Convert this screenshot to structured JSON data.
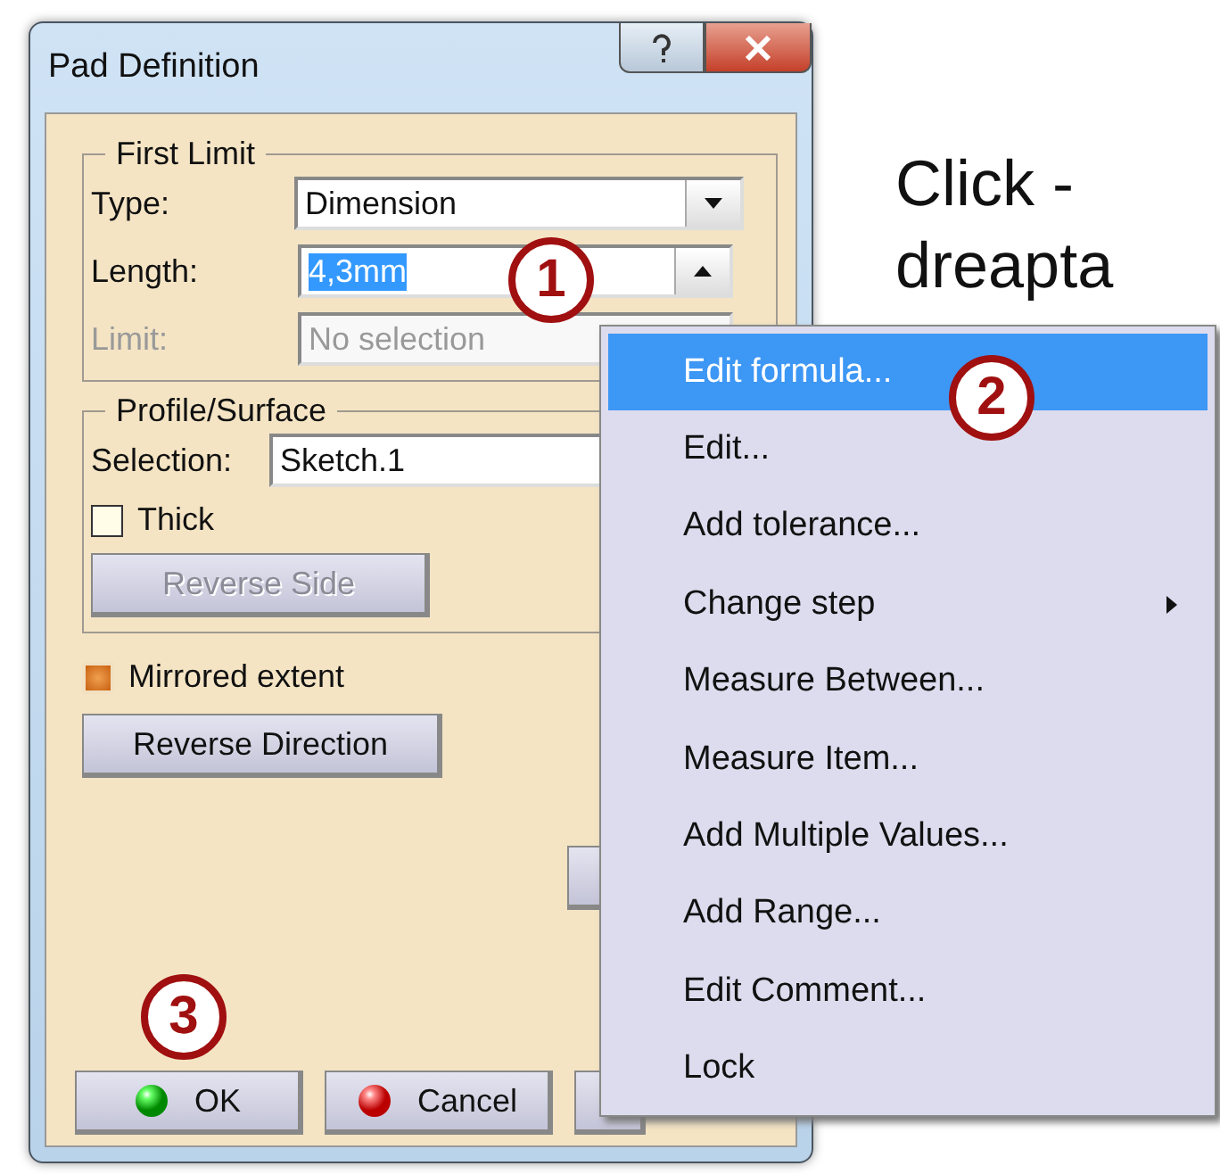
{
  "window": {
    "title": "Pad Definition"
  },
  "first_limit": {
    "title": "First Limit",
    "type": {
      "label": "Type:",
      "value": "Dimension"
    },
    "length": {
      "label": "Length:",
      "value": "4,3mm",
      "text_selected": true
    },
    "limit": {
      "label": "Limit:",
      "value": "No selection",
      "disabled": true
    }
  },
  "profile": {
    "title": "Profile/Surface",
    "selection": {
      "label": "Selection:",
      "value": "Sketch.1"
    },
    "thick": {
      "label": "Thick",
      "checked": false
    },
    "reverse_side": {
      "label": "Reverse Side",
      "disabled": true
    }
  },
  "mirrored_extent": {
    "label": "Mirrored extent",
    "checked": true
  },
  "reverse_direction": {
    "label": "Reverse Direction",
    "disabled": false
  },
  "buttons": [
    {
      "label": "OK",
      "kind": "ok"
    },
    {
      "label": "Cancel",
      "kind": "cancel"
    }
  ],
  "context_menu": {
    "items": [
      {
        "label": "Edit formula...",
        "selected": true,
        "submenu": false
      },
      {
        "label": "Edit...",
        "selected": false,
        "submenu": false
      },
      {
        "label": "Add tolerance...",
        "selected": false,
        "submenu": false
      },
      {
        "label": "Change step",
        "selected": false,
        "submenu": true
      },
      {
        "label": "Measure Between...",
        "selected": false,
        "submenu": false
      },
      {
        "label": "Measure Item...",
        "selected": false,
        "submenu": false
      },
      {
        "label": "Add Multiple Values...",
        "selected": false,
        "submenu": false
      },
      {
        "label": "Add Range...",
        "selected": false,
        "submenu": false
      },
      {
        "label": "Edit Comment...",
        "selected": false,
        "submenu": false
      },
      {
        "label": "Lock",
        "selected": false,
        "submenu": false
      }
    ]
  },
  "annotation": {
    "lines": [
      "Click -",
      "dreapta"
    ]
  },
  "steps": [
    "1",
    "2",
    "3"
  ]
}
